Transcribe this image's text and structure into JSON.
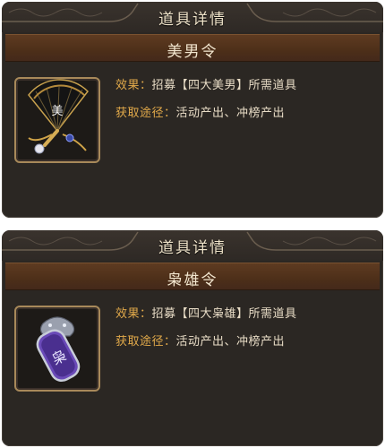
{
  "panels": [
    {
      "header_title": "道具详情",
      "item_name": "美男令",
      "effect_label": "效果：",
      "effect_value": "招募【四大美男】所需道具",
      "source_label": "获取途径：",
      "source_value": "活动产出、冲榜产出",
      "icon": "folding-fan-token-icon"
    },
    {
      "header_title": "道具详情",
      "item_name": "枭雄令",
      "effect_label": "效果：",
      "effect_value": "招募【四大枭雄】所需道具",
      "source_label": "获取途径：",
      "source_value": "活动产出、冲榜产出",
      "icon": "purple-dragon-plaque-icon",
      "icon_glyph": "枭"
    }
  ],
  "colors": {
    "panel_bg": "#2b2723",
    "name_bar": "#4d2f19",
    "label": "#e1a94a",
    "value": "#e8dcc6",
    "title": "#efe3c9"
  }
}
